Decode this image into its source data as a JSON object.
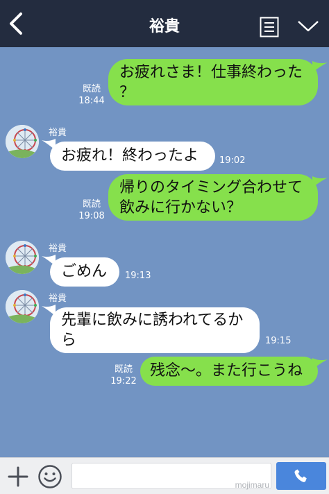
{
  "header": {
    "title": "裕貴",
    "back_icon": "chevron-left-icon",
    "menu_icon": "note-list-icon",
    "dropdown_icon": "chevron-down-icon"
  },
  "messages": [
    {
      "direction": "out",
      "lines": [
        "お疲れさま！仕事終わった",
        "？"
      ],
      "read": "既読",
      "time": "18:44"
    },
    {
      "direction": "in",
      "sender": "裕貴",
      "lines": [
        "お疲れ！終わったよ"
      ],
      "time": "19:02"
    },
    {
      "direction": "out",
      "lines": [
        "帰りのタイミング合わせて",
        "飲みに行かない？"
      ],
      "read": "既読",
      "time": "19:08"
    },
    {
      "direction": "in",
      "sender": "裕貴",
      "lines": [
        "ごめん"
      ],
      "time": "19:13"
    },
    {
      "direction": "in",
      "sender": "裕貴",
      "lines": [
        "先輩に飲みに誘われてるか",
        "ら"
      ],
      "time": "19:15"
    },
    {
      "direction": "out",
      "lines": [
        "残念〜。また行こうね"
      ],
      "read": "既読",
      "time": "19:22"
    }
  ],
  "footer": {
    "plus_icon": "plus-icon",
    "sticker_icon": "smiley-icon",
    "input_value": "",
    "watermark": "mojimaru",
    "call_icon": "phone-icon"
  },
  "colors": {
    "header_bg": "#232c3f",
    "chat_bg": "#7294c3",
    "outgoing_bubble": "#86e04c",
    "incoming_bubble": "#ffffff",
    "call_button": "#4a86dc"
  }
}
